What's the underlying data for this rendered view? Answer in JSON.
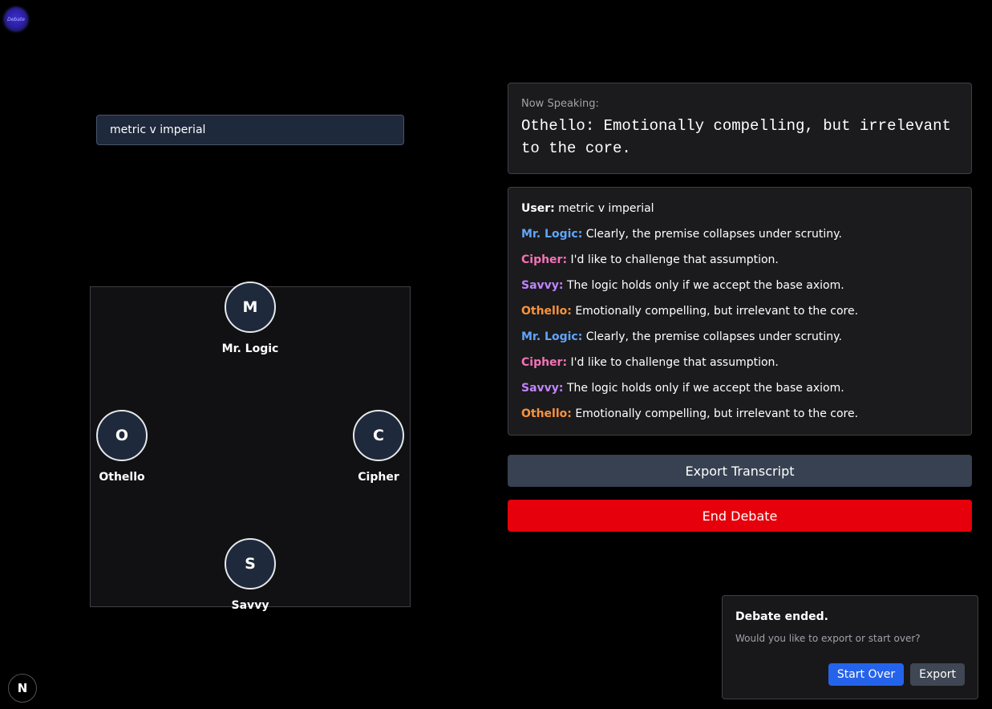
{
  "app": {
    "logo_text": "Debate"
  },
  "topic": {
    "value": "metric v imperial"
  },
  "colors": {
    "user": "#ffffff",
    "mr_logic": "#60a5fa",
    "cipher": "#f472b6",
    "savvy": "#c084fc",
    "othello": "#fb923c",
    "end_button": "#e5000b",
    "start_over_button": "#2563eb"
  },
  "arena": {
    "seats": [
      {
        "initial": "M",
        "name": "Mr. Logic"
      },
      {
        "initial": "O",
        "name": "Othello"
      },
      {
        "initial": "C",
        "name": "Cipher"
      },
      {
        "initial": "S",
        "name": "Savvy"
      }
    ]
  },
  "now_speaking": {
    "title": "Now Speaking:",
    "text": "Othello: Emotionally compelling, but irrelevant to the core."
  },
  "transcript": [
    {
      "speaker": "User:",
      "text": "metric v imperial"
    },
    {
      "speaker": "Mr. Logic:",
      "text": "Clearly, the premise collapses under scrutiny."
    },
    {
      "speaker": "Cipher:",
      "text": "I'd like to challenge that assumption."
    },
    {
      "speaker": "Savvy:",
      "text": "The logic holds only if we accept the base axiom."
    },
    {
      "speaker": "Othello:",
      "text": "Emotionally compelling, but irrelevant to the core."
    },
    {
      "speaker": "Mr. Logic:",
      "text": "Clearly, the premise collapses under scrutiny."
    },
    {
      "speaker": "Cipher:",
      "text": "I'd like to challenge that assumption."
    },
    {
      "speaker": "Savvy:",
      "text": "The logic holds only if we accept the base axiom."
    },
    {
      "speaker": "Othello:",
      "text": "Emotionally compelling, but irrelevant to the core."
    }
  ],
  "buttons": {
    "export_transcript": "Export Transcript",
    "end_debate": "End Debate"
  },
  "dialog": {
    "title": "Debate ended.",
    "message": "Would you like to export or start over?",
    "start_over": "Start Over",
    "export": "Export"
  },
  "dev_badge": {
    "letter": "N"
  }
}
